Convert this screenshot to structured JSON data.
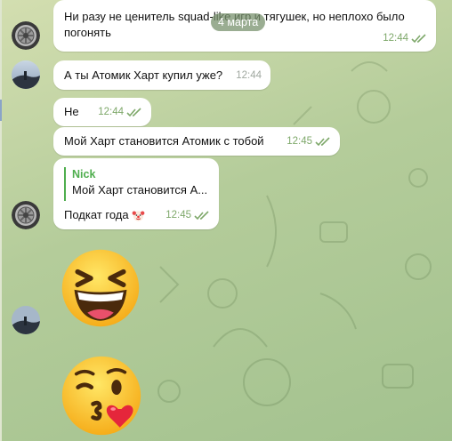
{
  "chat": {
    "date_pill": "4 марта",
    "messages": [
      {
        "line1": "Ни разу не ценитель squad-like игр и тягушек, но неплохо было",
        "line2": "погонять",
        "time": "12:44"
      },
      {
        "text": "А ты Атомик Харт купил уже?",
        "time": "12:44"
      },
      {
        "text": "Не",
        "time": "12:44"
      },
      {
        "text": "Мой Харт становится Атомик с тобой",
        "time": "12:45"
      },
      {
        "reply_name": "Nick",
        "reply_text": "Мой Харт становится А...",
        "text": "Подкат года",
        "time": "12:45"
      }
    ],
    "stickers": [
      {
        "icon": "squinting-laughing-face-emoji"
      },
      {
        "icon": "winking-kiss-face-emoji"
      }
    ]
  },
  "colors": {
    "accent_green": "#4fae4e",
    "time_green": "#7ea86a",
    "bubble": "#ffffff"
  }
}
